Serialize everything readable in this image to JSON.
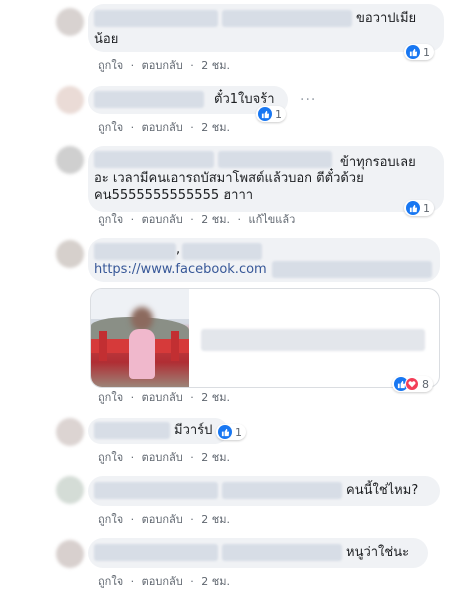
{
  "comments": [
    {
      "text": "ขอวาปเมีย",
      "text2": "น้อย",
      "like": "ถูกใจ",
      "reply": "ตอบกลับ",
      "time": "2 ชม.",
      "reactions": "1"
    },
    {
      "text": "ตั๋ว1ใบจร้า",
      "like": "ถูกใจ",
      "reply": "ตอบกลับ",
      "time": "2 ชม.",
      "reactions": "1"
    },
    {
      "line1": "ข้าทุกรอบเลย",
      "line2": "อะ เวลามีคนเอารถบัสมาโพสต์แล้วบอก ตีตั๋วด้วย",
      "line3": "คน5555555555555 ฮาาา",
      "like": "ถูกใจ",
      "reply": "ตอบกลับ",
      "time": "2 ชม.",
      "edited": "แก้ไขแล้ว",
      "reactions": "1"
    },
    {
      "comma": ",",
      "url": "https://www.facebook.com",
      "like": "ถูกใจ",
      "reply": "ตอบกลับ",
      "time": "2 ชม.",
      "reactions": "8"
    },
    {
      "text": "มีวาร์ป",
      "like": "ถูกใจ",
      "reply": "ตอบกลับ",
      "time": "2 ชม.",
      "reactions": "1"
    },
    {
      "text": "คนนี้ใช่ไหม?",
      "like": "ถูกใจ",
      "reply": "ตอบกลับ",
      "time": "2 ชม."
    },
    {
      "text": "หนูว่าใช่นะ",
      "like": "ถูกใจ",
      "reply": "ตอบกลับ",
      "time": "2 ชม."
    }
  ],
  "separator": "·",
  "colors": {
    "like_blue": "#1877f2",
    "love_red": "#f33e58",
    "bubble": "#f0f2f5"
  }
}
